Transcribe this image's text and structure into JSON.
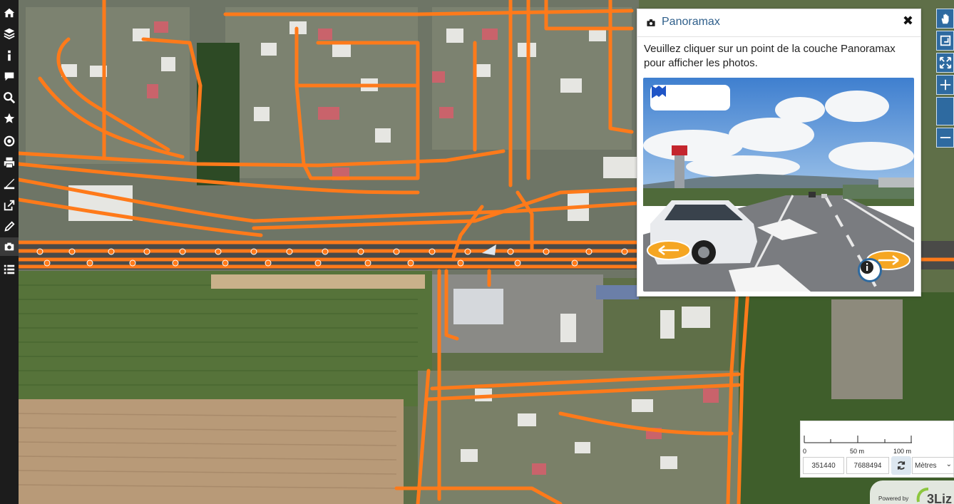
{
  "left_toolbar": {
    "items": [
      {
        "name": "home-icon"
      },
      {
        "name": "layers-icon"
      },
      {
        "name": "info-icon"
      },
      {
        "name": "comment-icon"
      },
      {
        "name": "search-icon"
      },
      {
        "name": "star-icon"
      },
      {
        "name": "locate-icon"
      },
      {
        "name": "print-icon"
      },
      {
        "name": "measure-icon"
      },
      {
        "name": "share-icon"
      },
      {
        "name": "edit-icon"
      },
      {
        "name": "camera-icon"
      },
      {
        "name": "list-icon"
      }
    ],
    "active": "camera-icon"
  },
  "right_toolbar": {
    "items": [
      "pan-icon",
      "zoom-box-icon",
      "zoom-extent-icon",
      "zoom-in-icon",
      "zoom-out-icon"
    ]
  },
  "panoramax": {
    "title": "Panoramax",
    "close_label": "✖",
    "instruction": "Veuillez cliquer sur un point de la couche Panoramax pour afficher les photos.",
    "controls": [
      "rewind-icon",
      "play-icon",
      "fast-forward-icon"
    ]
  },
  "scale": {
    "labels": [
      "0",
      "50 m",
      "100 m"
    ]
  },
  "coordinates": {
    "x": "351440",
    "y": "7688494"
  },
  "unit_select": {
    "selected": "Mètres"
  },
  "powered_by": {
    "text": "Powered by",
    "logo_text": "3Liz"
  },
  "colors": {
    "route": "#ff7a1a",
    "toolbar_bg": "#1c1c1c",
    "accent": "#2e6aa0"
  }
}
